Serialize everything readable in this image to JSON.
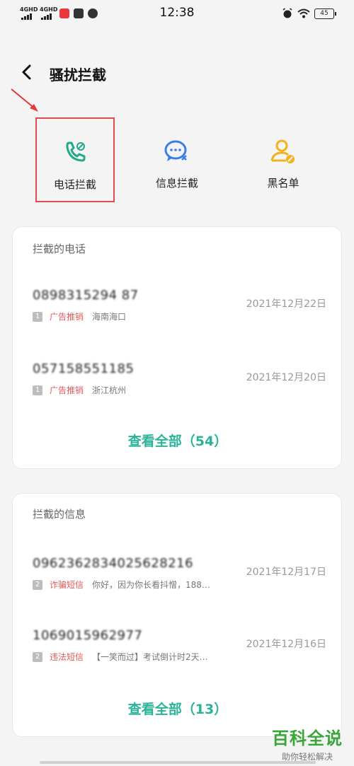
{
  "status_bar": {
    "net1": "4GHD",
    "net2": "4GHD",
    "time": "12:38",
    "battery": "45"
  },
  "header": {
    "title": "骚扰拦截"
  },
  "tiles": [
    {
      "label": "电话拦截",
      "icon": "phone-block-icon",
      "color": "#22a98a",
      "selected": true
    },
    {
      "label": "信息拦截",
      "icon": "message-block-icon",
      "color": "#3b7de8",
      "selected": false
    },
    {
      "label": "黑名单",
      "icon": "blacklist-user-icon",
      "color": "#f2b21c",
      "selected": false
    }
  ],
  "calls_card": {
    "title": "拦截的电话",
    "items": [
      {
        "number": "0898315294 87",
        "sim": "1",
        "tag": "广告推销",
        "desc": "海南海口",
        "date": "2021年12月22日"
      },
      {
        "number": "057158551185",
        "sim": "1",
        "tag": "广告推销",
        "desc": "浙江杭州",
        "date": "2021年12月20日"
      }
    ],
    "view_all": "查看全部（54）"
  },
  "messages_card": {
    "title": "拦截的信息",
    "items": [
      {
        "number": "0962362834025628216",
        "sim": "2",
        "tag": "诈骗短信",
        "desc": "你好，因为你长看抖憎，188…",
        "date": "2021年12月17日"
      },
      {
        "number": "1069015962977",
        "sim": "2",
        "tag": "违法短信",
        "desc": "【一笑而过】考试倒计时2天…",
        "date": "2021年12月16日"
      }
    ],
    "view_all": "查看全部（13）"
  },
  "watermark": {
    "title": "百科全说",
    "subtitle": "助你轻松解决"
  },
  "colors": {
    "accent_green": "#2bb39a",
    "tag_red": "#e05a5a",
    "highlight_red": "#e24b4b"
  }
}
